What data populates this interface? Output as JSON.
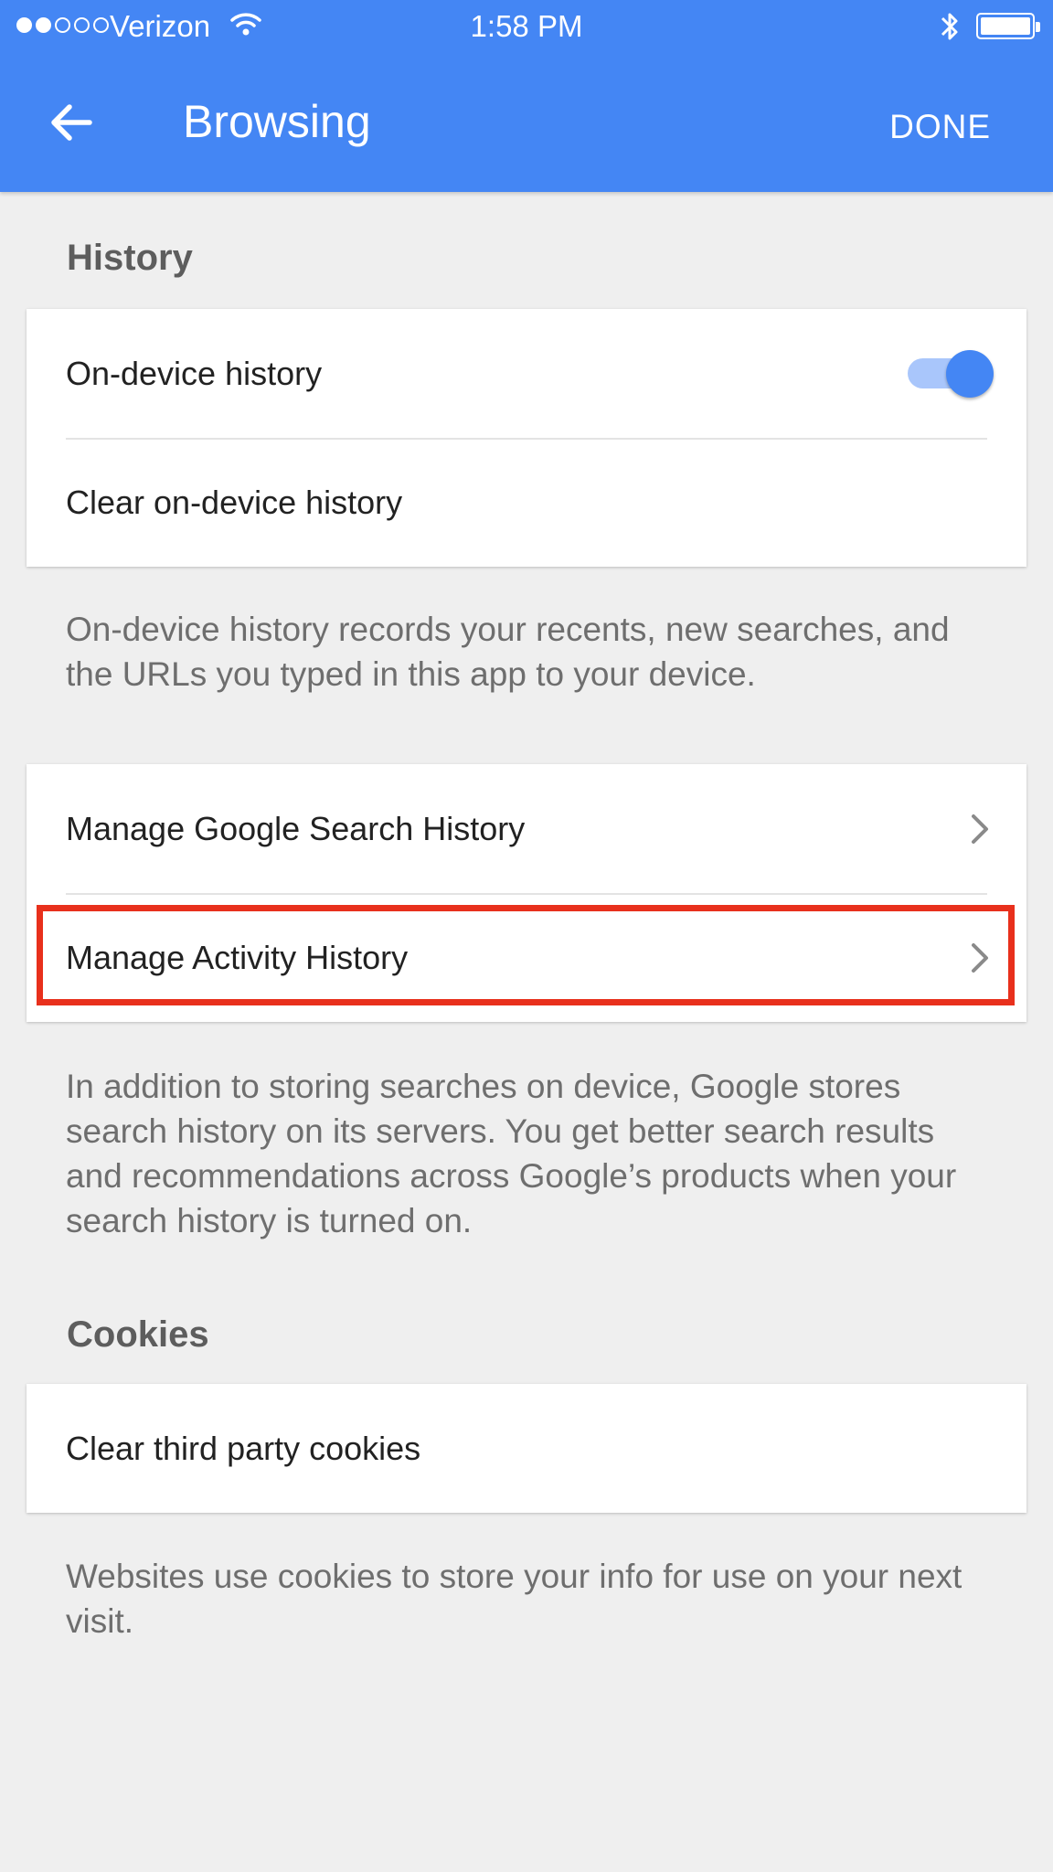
{
  "status_bar": {
    "signal_dots_filled": 2,
    "signal_dots_total": 5,
    "carrier": "Verizon",
    "time": "1:58 PM",
    "icons": [
      "wifi-icon",
      "bluetooth-icon",
      "battery-icon"
    ]
  },
  "header": {
    "title": "Browsing",
    "done_label": "DONE",
    "back_icon": "arrow-left-icon",
    "background_color": "#4486f4"
  },
  "history": {
    "section_title": "History",
    "on_device_label": "On-device history",
    "on_device_enabled": true,
    "clear_label": "Clear on-device history",
    "help_text": "On-device history records your recents, new searches, and the URLs you typed in this app to your device."
  },
  "manage": {
    "search_history_label": "Manage Google Search History",
    "activity_history_label": "Manage Activity History",
    "help_text": "In addition to storing searches on device, Google stores search history on its servers. You get better search results and recommendations across Google’s products when your search history is turned on.",
    "highlight_color": "#e8301c"
  },
  "cookies": {
    "section_title": "Cookies",
    "clear_label": "Clear third party cookies",
    "help_text": "Websites use cookies to store your info for use on your next visit."
  }
}
